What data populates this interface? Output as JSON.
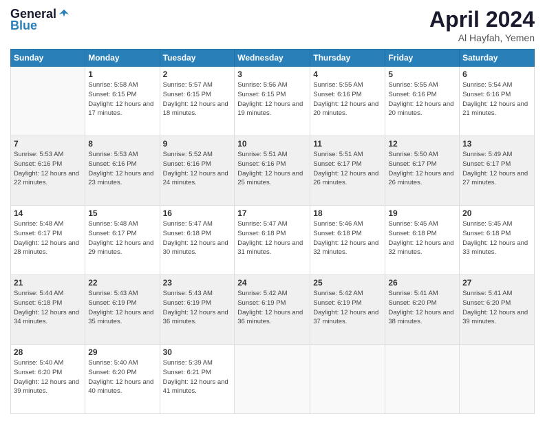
{
  "logo": {
    "general": "General",
    "blue": "Blue"
  },
  "title": "April 2024",
  "location": "Al Hayfah, Yemen",
  "days_of_week": [
    "Sunday",
    "Monday",
    "Tuesday",
    "Wednesday",
    "Thursday",
    "Friday",
    "Saturday"
  ],
  "weeks": [
    [
      {
        "day": null
      },
      {
        "day": "1",
        "sunrise": "5:58 AM",
        "sunset": "6:15 PM",
        "daylight": "12 hours and 17 minutes."
      },
      {
        "day": "2",
        "sunrise": "5:57 AM",
        "sunset": "6:15 PM",
        "daylight": "12 hours and 18 minutes."
      },
      {
        "day": "3",
        "sunrise": "5:56 AM",
        "sunset": "6:15 PM",
        "daylight": "12 hours and 19 minutes."
      },
      {
        "day": "4",
        "sunrise": "5:55 AM",
        "sunset": "6:16 PM",
        "daylight": "12 hours and 20 minutes."
      },
      {
        "day": "5",
        "sunrise": "5:55 AM",
        "sunset": "6:16 PM",
        "daylight": "12 hours and 20 minutes."
      },
      {
        "day": "6",
        "sunrise": "5:54 AM",
        "sunset": "6:16 PM",
        "daylight": "12 hours and 21 minutes."
      }
    ],
    [
      {
        "day": "7",
        "sunrise": "5:53 AM",
        "sunset": "6:16 PM",
        "daylight": "12 hours and 22 minutes."
      },
      {
        "day": "8",
        "sunrise": "5:53 AM",
        "sunset": "6:16 PM",
        "daylight": "12 hours and 23 minutes."
      },
      {
        "day": "9",
        "sunrise": "5:52 AM",
        "sunset": "6:16 PM",
        "daylight": "12 hours and 24 minutes."
      },
      {
        "day": "10",
        "sunrise": "5:51 AM",
        "sunset": "6:16 PM",
        "daylight": "12 hours and 25 minutes."
      },
      {
        "day": "11",
        "sunrise": "5:51 AM",
        "sunset": "6:17 PM",
        "daylight": "12 hours and 26 minutes."
      },
      {
        "day": "12",
        "sunrise": "5:50 AM",
        "sunset": "6:17 PM",
        "daylight": "12 hours and 26 minutes."
      },
      {
        "day": "13",
        "sunrise": "5:49 AM",
        "sunset": "6:17 PM",
        "daylight": "12 hours and 27 minutes."
      }
    ],
    [
      {
        "day": "14",
        "sunrise": "5:48 AM",
        "sunset": "6:17 PM",
        "daylight": "12 hours and 28 minutes."
      },
      {
        "day": "15",
        "sunrise": "5:48 AM",
        "sunset": "6:17 PM",
        "daylight": "12 hours and 29 minutes."
      },
      {
        "day": "16",
        "sunrise": "5:47 AM",
        "sunset": "6:18 PM",
        "daylight": "12 hours and 30 minutes."
      },
      {
        "day": "17",
        "sunrise": "5:47 AM",
        "sunset": "6:18 PM",
        "daylight": "12 hours and 31 minutes."
      },
      {
        "day": "18",
        "sunrise": "5:46 AM",
        "sunset": "6:18 PM",
        "daylight": "12 hours and 32 minutes."
      },
      {
        "day": "19",
        "sunrise": "5:45 AM",
        "sunset": "6:18 PM",
        "daylight": "12 hours and 32 minutes."
      },
      {
        "day": "20",
        "sunrise": "5:45 AM",
        "sunset": "6:18 PM",
        "daylight": "12 hours and 33 minutes."
      }
    ],
    [
      {
        "day": "21",
        "sunrise": "5:44 AM",
        "sunset": "6:18 PM",
        "daylight": "12 hours and 34 minutes."
      },
      {
        "day": "22",
        "sunrise": "5:43 AM",
        "sunset": "6:19 PM",
        "daylight": "12 hours and 35 minutes."
      },
      {
        "day": "23",
        "sunrise": "5:43 AM",
        "sunset": "6:19 PM",
        "daylight": "12 hours and 36 minutes."
      },
      {
        "day": "24",
        "sunrise": "5:42 AM",
        "sunset": "6:19 PM",
        "daylight": "12 hours and 36 minutes."
      },
      {
        "day": "25",
        "sunrise": "5:42 AM",
        "sunset": "6:19 PM",
        "daylight": "12 hours and 37 minutes."
      },
      {
        "day": "26",
        "sunrise": "5:41 AM",
        "sunset": "6:20 PM",
        "daylight": "12 hours and 38 minutes."
      },
      {
        "day": "27",
        "sunrise": "5:41 AM",
        "sunset": "6:20 PM",
        "daylight": "12 hours and 39 minutes."
      }
    ],
    [
      {
        "day": "28",
        "sunrise": "5:40 AM",
        "sunset": "6:20 PM",
        "daylight": "12 hours and 39 minutes."
      },
      {
        "day": "29",
        "sunrise": "5:40 AM",
        "sunset": "6:20 PM",
        "daylight": "12 hours and 40 minutes."
      },
      {
        "day": "30",
        "sunrise": "5:39 AM",
        "sunset": "6:21 PM",
        "daylight": "12 hours and 41 minutes."
      },
      {
        "day": null
      },
      {
        "day": null
      },
      {
        "day": null
      },
      {
        "day": null
      }
    ]
  ]
}
